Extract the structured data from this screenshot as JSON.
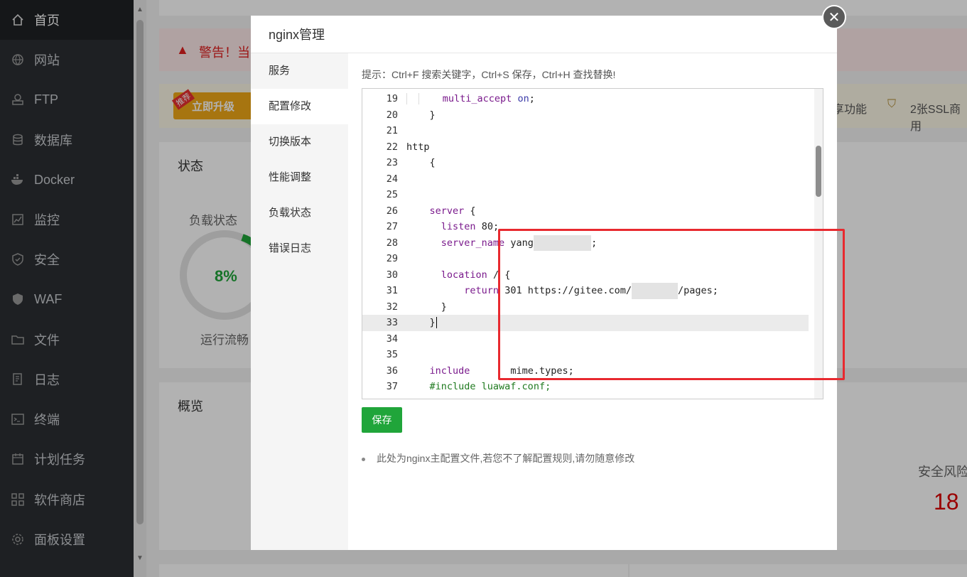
{
  "sidebar": {
    "items": [
      {
        "label": "首页",
        "icon": "home-icon"
      },
      {
        "label": "网站",
        "icon": "globe-icon"
      },
      {
        "label": "FTP",
        "icon": "ftp-icon"
      },
      {
        "label": "数据库",
        "icon": "database-icon"
      },
      {
        "label": "Docker",
        "icon": "docker-icon"
      },
      {
        "label": "监控",
        "icon": "monitor-icon"
      },
      {
        "label": "安全",
        "icon": "shield-icon"
      },
      {
        "label": "WAF",
        "icon": "waf-icon"
      },
      {
        "label": "文件",
        "icon": "folder-icon"
      },
      {
        "label": "日志",
        "icon": "log-icon"
      },
      {
        "label": "终端",
        "icon": "terminal-icon"
      },
      {
        "label": "计划任务",
        "icon": "calendar-icon"
      },
      {
        "label": "软件商店",
        "icon": "apps-icon"
      },
      {
        "label": "面板设置",
        "icon": "gear-icon"
      }
    ]
  },
  "background": {
    "warning": "警告！当前",
    "upgrade_badge": "推荐",
    "upgrade_button": "立即升级",
    "feature_text": "享功能",
    "ssl_text": "2张SSL商用",
    "status_title": "状态",
    "load_label": "负载状态",
    "load_value": "8%",
    "load_status": "运行流畅",
    "overview_title": "概览",
    "risk_label": "安全风险",
    "risk_value": "18"
  },
  "modal": {
    "title": "nginx管理",
    "nav": [
      "服务",
      "配置修改",
      "切换版本",
      "性能调整",
      "负载状态",
      "错误日志"
    ],
    "active_nav": "配置修改",
    "hint": "提示：Ctrl+F 搜索关键字，Ctrl+S 保存，Ctrl+H 查找替换!",
    "save_label": "保存",
    "note": "此处为nginx主配置文件,若您不了解配置规则,请勿随意修改"
  },
  "editor": {
    "lines": [
      {
        "n": "19",
        "text": "multi_accept on;"
      },
      {
        "n": "20",
        "text": "}"
      },
      {
        "n": "21",
        "text": ""
      },
      {
        "n": "22",
        "text": "http"
      },
      {
        "n": "23",
        "text": "{"
      },
      {
        "n": "24",
        "text": ""
      },
      {
        "n": "25",
        "text": ""
      },
      {
        "n": "26",
        "text": "server {"
      },
      {
        "n": "27",
        "text": "listen 80;"
      },
      {
        "n": "28",
        "text": "server_name yang"
      },
      {
        "n": "29",
        "text": ""
      },
      {
        "n": "30",
        "text": "location / {"
      },
      {
        "n": "31",
        "text": "return 301 https://gitee.com/"
      },
      {
        "n": "32",
        "text": "}"
      },
      {
        "n": "33",
        "text": "}"
      },
      {
        "n": "34",
        "text": ""
      },
      {
        "n": "35",
        "text": ""
      },
      {
        "n": "36",
        "text": "include       mime.types;"
      },
      {
        "n": "37",
        "text": "#include luawaf.conf;"
      }
    ],
    "tail_28": ";",
    "tail_31": "/pages;"
  },
  "colors": {
    "accent": "#20a53a",
    "highlight": "#e8292f",
    "sidebar_bg": "#2b2f33"
  }
}
